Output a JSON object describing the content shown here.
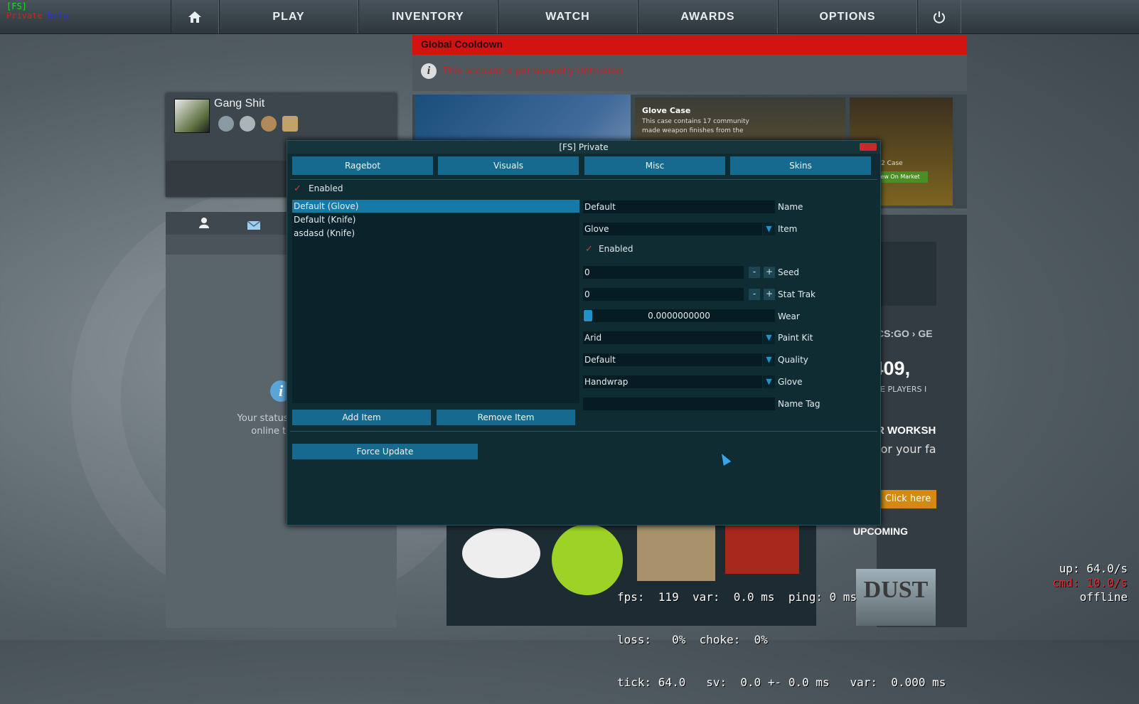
{
  "overlay_tag": {
    "fs": "[FS]",
    "private": "Private",
    "beta": "beta"
  },
  "nav": {
    "items": [
      "PLAY",
      "INVENTORY",
      "WATCH",
      "AWARDS",
      "OPTIONS"
    ],
    "home_icon": "home-icon",
    "power_icon": "power-icon"
  },
  "profile": {
    "name": "Gang Shit"
  },
  "friends": {
    "status_line1": "Your status is currently",
    "status_line2": "online to see frie"
  },
  "cooldown": {
    "title": "Global Cooldown",
    "message": "This account is permanently Untrusted"
  },
  "store": {
    "glove_title": "Glove Case",
    "glove_desc": "This case contains 17 community made weapon finishes from the",
    "case3_label": "na 2 Case",
    "market_btn": "iew On Market"
  },
  "news": {
    "csgo": "CS:GO › GE",
    "players": "1,409,",
    "unique": "UE PLAYERS I",
    "workshop": "R WORKSH",
    "foryour": "for your fa",
    "click_here": "Click here",
    "upcoming": "UPCOMING",
    "dust": "DUST"
  },
  "dialog": {
    "title": "[FS] Private",
    "tabs": [
      "Ragebot",
      "Visuals",
      "Misc",
      "Skins"
    ],
    "enabled_label": "Enabled",
    "items": [
      "Default (Glove)",
      "Default (Knife)",
      "asdasd (Knife)"
    ],
    "selected_index": 0,
    "add_item": "Add Item",
    "remove_item": "Remove Item",
    "force_update": "Force Update",
    "name": {
      "value": "Default",
      "label": "Name"
    },
    "item": {
      "value": "Glove",
      "label": "Item"
    },
    "item_enabled": "Enabled",
    "seed": {
      "value": "0",
      "label": "Seed"
    },
    "stattrak": {
      "value": "0",
      "label": "Stat Trak"
    },
    "wear": {
      "value": "0.0000000000",
      "label": "Wear"
    },
    "paint_kit": {
      "value": "Arid",
      "label": "Paint Kit"
    },
    "quality": {
      "value": "Default",
      "label": "Quality"
    },
    "glove": {
      "value": "Handwrap",
      "label": "Glove"
    },
    "name_tag": {
      "value": "",
      "label": "Name Tag"
    },
    "minus": "-",
    "plus": "+"
  },
  "netgraph": {
    "line1": "fps:  119  var:  0.0 ms  ping: 0 ms",
    "line2": "loss:   0%  choke:  0%",
    "line3": "tick: 64.0   sv:  0.0 +- 0.0 ms   var:  0.000 ms",
    "up": "up: 64.0/s",
    "cmd": "cmd: 10.0/s",
    "offline": "offline"
  },
  "colors": {
    "accent": "#176a8f",
    "selected": "#167aa8",
    "warning": "#d31212",
    "check": "#d23a3a"
  }
}
